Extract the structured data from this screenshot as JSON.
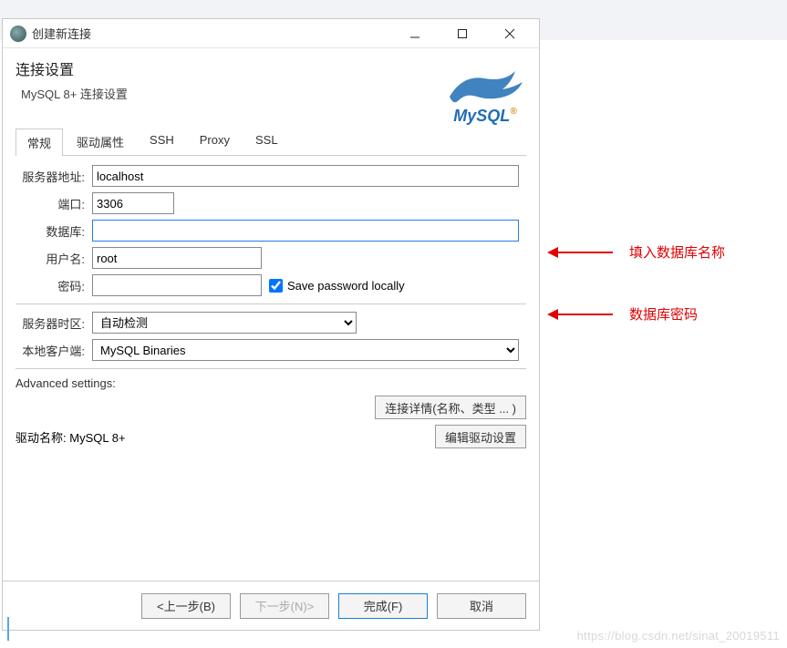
{
  "titlebar": {
    "title": "创建新连接"
  },
  "header": {
    "title": "连接设置",
    "subtitle": "MySQL 8+ 连接设置",
    "logo_text": "MySQL"
  },
  "tabs": [
    {
      "label": "常规",
      "active": true
    },
    {
      "label": "驱动属性",
      "active": false
    },
    {
      "label": "SSH",
      "active": false
    },
    {
      "label": "Proxy",
      "active": false
    },
    {
      "label": "SSL",
      "active": false
    }
  ],
  "form": {
    "server_label": "服务器地址:",
    "server_value": "localhost",
    "port_label": "端口:",
    "port_value": "3306",
    "database_label": "数据库:",
    "database_value": "",
    "username_label": "用户名:",
    "username_value": "root",
    "password_label": "密码:",
    "password_value": "",
    "save_password_label": "Save password locally",
    "save_password_checked": true,
    "timezone_label": "服务器时区:",
    "timezone_value": "自动检测",
    "local_client_label": "本地客户端:",
    "local_client_value": "MySQL Binaries"
  },
  "advanced": {
    "label": "Advanced settings:",
    "details_button": "连接详情(名称、类型 ... )"
  },
  "driver": {
    "label": "驱动名称:",
    "value": "MySQL 8+",
    "edit_button": "编辑驱动设置"
  },
  "footer": {
    "back": "<上一步(B)",
    "next": "下一步(N)>",
    "finish": "完成(F)",
    "cancel": "取消"
  },
  "annotations": {
    "database": "填入数据库名称",
    "password": "数据库密码"
  },
  "watermark": "https://blog.csdn.net/sinat_20019511"
}
